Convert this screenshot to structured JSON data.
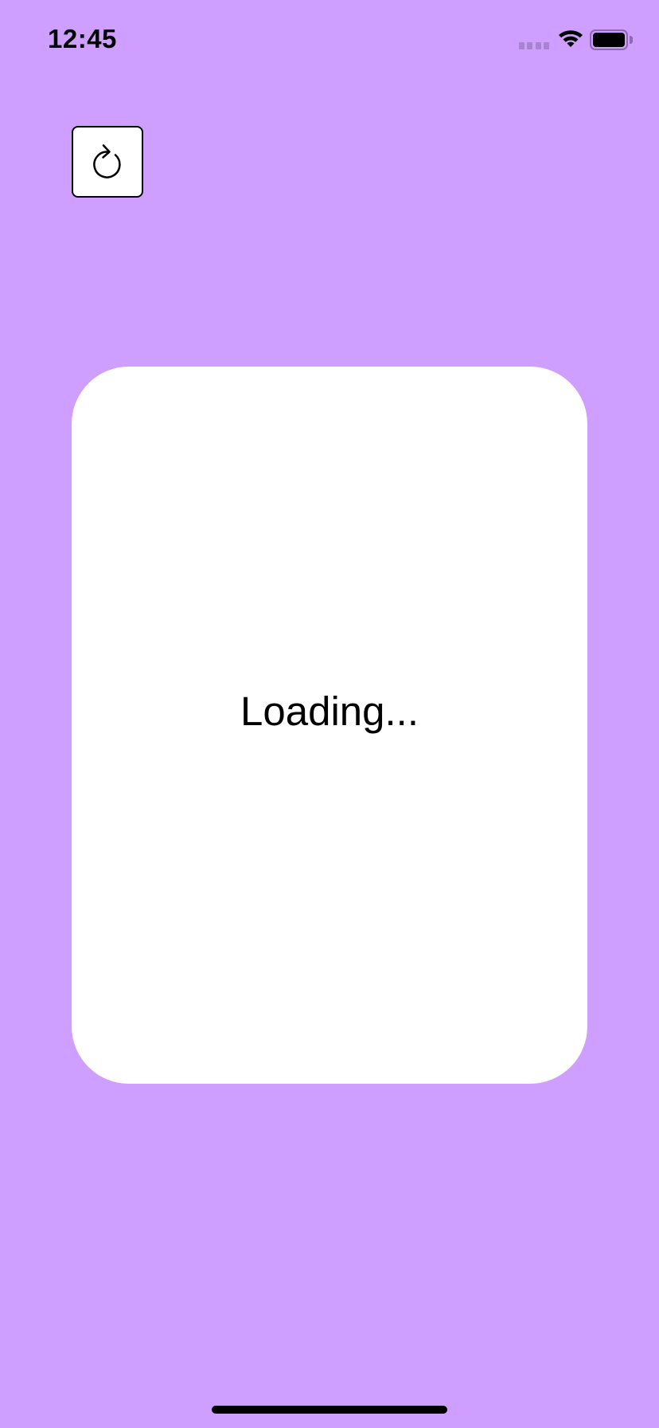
{
  "status_bar": {
    "time": "12:45",
    "icons": [
      "signal-icon",
      "wifi-icon",
      "battery-icon"
    ],
    "colors": {
      "signal": "#a883cf",
      "battery_outline": "#8e68b5"
    }
  },
  "toolbar": {
    "refresh_icon": "refresh-icon"
  },
  "card": {
    "loading_text": "Loading..."
  },
  "colors": {
    "background": "#cf9fff",
    "card": "#ffffff",
    "text": "#000000"
  }
}
